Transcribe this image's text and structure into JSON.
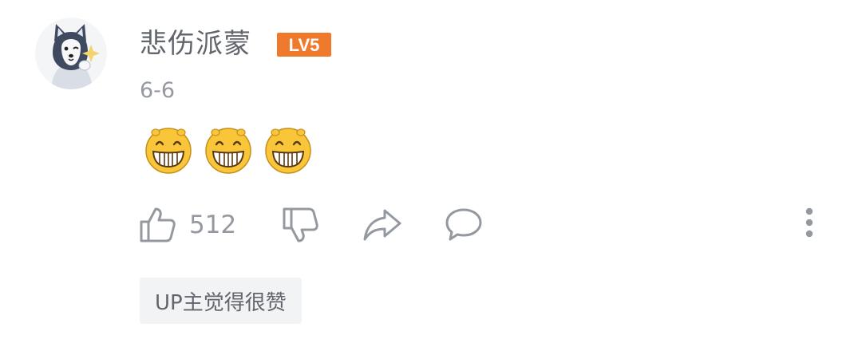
{
  "comment": {
    "username": "悲伤派蒙",
    "level": "LV5",
    "date": "6-6",
    "emojis": [
      "grin-emoji",
      "grin-emoji",
      "grin-emoji"
    ],
    "like_count": "512",
    "up_tag": "UP主觉得很赞"
  },
  "icons": {
    "like": "thumbs-up-icon",
    "dislike": "thumbs-down-icon",
    "share": "share-arrow-icon",
    "comment": "speech-bubble-icon",
    "more": "more-vertical-icon"
  },
  "colors": {
    "text": "#61666d",
    "muted": "#9499a0",
    "level_badge": "#f07a2b",
    "tag_bg": "#f2f3f5",
    "emoji_yellow": "#f9c63a"
  }
}
